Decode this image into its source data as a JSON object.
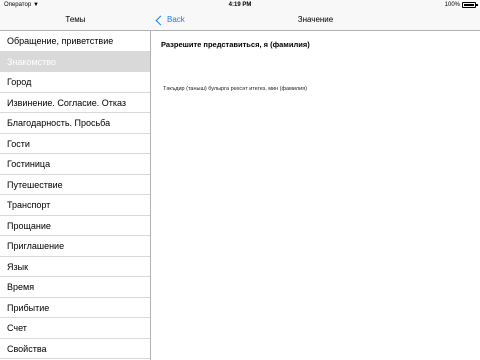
{
  "status_bar": {
    "carrier": "Оператор",
    "time": "4:19 PM",
    "battery": "100%"
  },
  "master": {
    "title": "Темы",
    "items": [
      {
        "label": "Обращение, приветствие"
      },
      {
        "label": "Знакомство"
      },
      {
        "label": "Город"
      },
      {
        "label": "Извинение. Согласие. Отказ"
      },
      {
        "label": "Благодарность. Просьба"
      },
      {
        "label": "Гости"
      },
      {
        "label": "Гостиница"
      },
      {
        "label": "Путешествие"
      },
      {
        "label": "Транспорт"
      },
      {
        "label": "Прощание"
      },
      {
        "label": "Приглашение"
      },
      {
        "label": "Язык"
      },
      {
        "label": "Время"
      },
      {
        "label": "Прибытие"
      },
      {
        "label": "Счет"
      },
      {
        "label": "Свойства"
      }
    ],
    "selected_index": 1
  },
  "detail": {
    "back_label": "Back",
    "title": "Значение",
    "phrase": "Разрешите представиться, я (фамилия)",
    "translation": "Тәкъдир (таныш) булырга рөхсәт итегез, мин (фамилия)"
  },
  "colors": {
    "accent": "#1a7cf5",
    "selected_row": "#d9d9d9",
    "nav_background": "#f8f8f8"
  }
}
